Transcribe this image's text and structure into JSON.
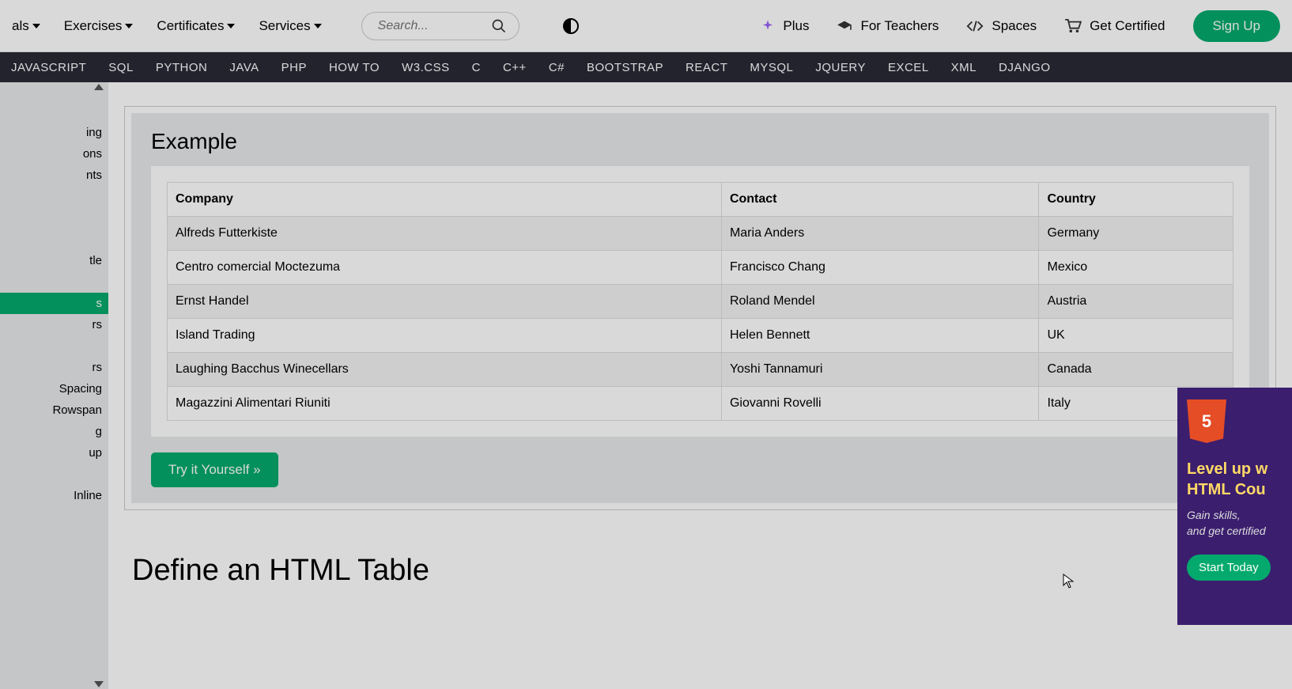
{
  "topnav": {
    "items": [
      "als",
      "Exercises",
      "Certificates",
      "Services"
    ],
    "search_placeholder": "Search...",
    "plus": "Plus",
    "teachers": "For Teachers",
    "spaces": "Spaces",
    "certified": "Get Certified",
    "signup": "Sign Up"
  },
  "subnav": [
    "JAVASCRIPT",
    "SQL",
    "PYTHON",
    "JAVA",
    "PHP",
    "HOW TO",
    "W3.CSS",
    "C",
    "C++",
    "C#",
    "BOOTSTRAP",
    "REACT",
    "MYSQL",
    "JQUERY",
    "EXCEL",
    "XML",
    "DJANGO"
  ],
  "sidebar": {
    "items": [
      {
        "label": "ing",
        "active": false
      },
      {
        "label": "ons",
        "active": false
      },
      {
        "label": "nts",
        "active": false
      },
      {
        "label": "",
        "active": false
      },
      {
        "label": "",
        "active": false
      },
      {
        "label": "",
        "active": false
      },
      {
        "label": "tle",
        "active": false
      },
      {
        "label": "",
        "active": false
      },
      {
        "label": "s",
        "active": true
      },
      {
        "label": "rs",
        "active": false
      },
      {
        "label": "",
        "active": false
      },
      {
        "label": "rs",
        "active": false
      },
      {
        "label": "Spacing",
        "active": false
      },
      {
        "label": "Rowspan",
        "active": false
      },
      {
        "label": "g",
        "active": false
      },
      {
        "label": "up",
        "active": false
      },
      {
        "label": "",
        "active": false
      },
      {
        "label": "Inline",
        "active": false
      }
    ]
  },
  "example": {
    "title": "Example",
    "headers": [
      "Company",
      "Contact",
      "Country"
    ],
    "rows": [
      [
        "Alfreds Futterkiste",
        "Maria Anders",
        "Germany"
      ],
      [
        "Centro comercial Moctezuma",
        "Francisco Chang",
        "Mexico"
      ],
      [
        "Ernst Handel",
        "Roland Mendel",
        "Austria"
      ],
      [
        "Island Trading",
        "Helen Bennett",
        "UK"
      ],
      [
        "Laughing Bacchus Winecellars",
        "Yoshi Tannamuri",
        "Canada"
      ],
      [
        "Magazzini Alimentari Riuniti",
        "Giovanni Rovelli",
        "Italy"
      ]
    ],
    "try_button": "Try it Yourself »"
  },
  "section_heading": "Define an HTML Table",
  "ad": {
    "icon_text": "5",
    "title1": "Level up w",
    "title2": "HTML Cou",
    "sub1": "Gain skills,",
    "sub2": "and get certified",
    "button": "Start Today"
  }
}
